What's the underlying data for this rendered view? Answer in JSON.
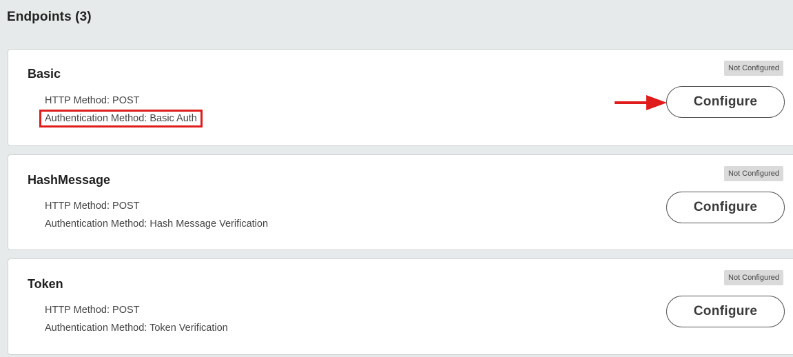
{
  "section": {
    "title": "Endpoints (3)"
  },
  "endpoints": [
    {
      "name": "Basic",
      "http_method": "HTTP Method: POST",
      "auth_method": "Authentication Method: Basic Auth",
      "status": "Not Configured",
      "action_label": "Configure"
    },
    {
      "name": "HashMessage",
      "http_method": "HTTP Method: POST",
      "auth_method": "Authentication Method: Hash Message Verification",
      "status": "Not Configured",
      "action_label": "Configure"
    },
    {
      "name": "Token",
      "http_method": "HTTP Method: POST",
      "auth_method": "Authentication Method: Token Verification",
      "status": "Not Configured",
      "action_label": "Configure"
    }
  ],
  "annotations": {
    "highlight_color": "#e01b1b",
    "arrow_color": "#e01b1b"
  }
}
